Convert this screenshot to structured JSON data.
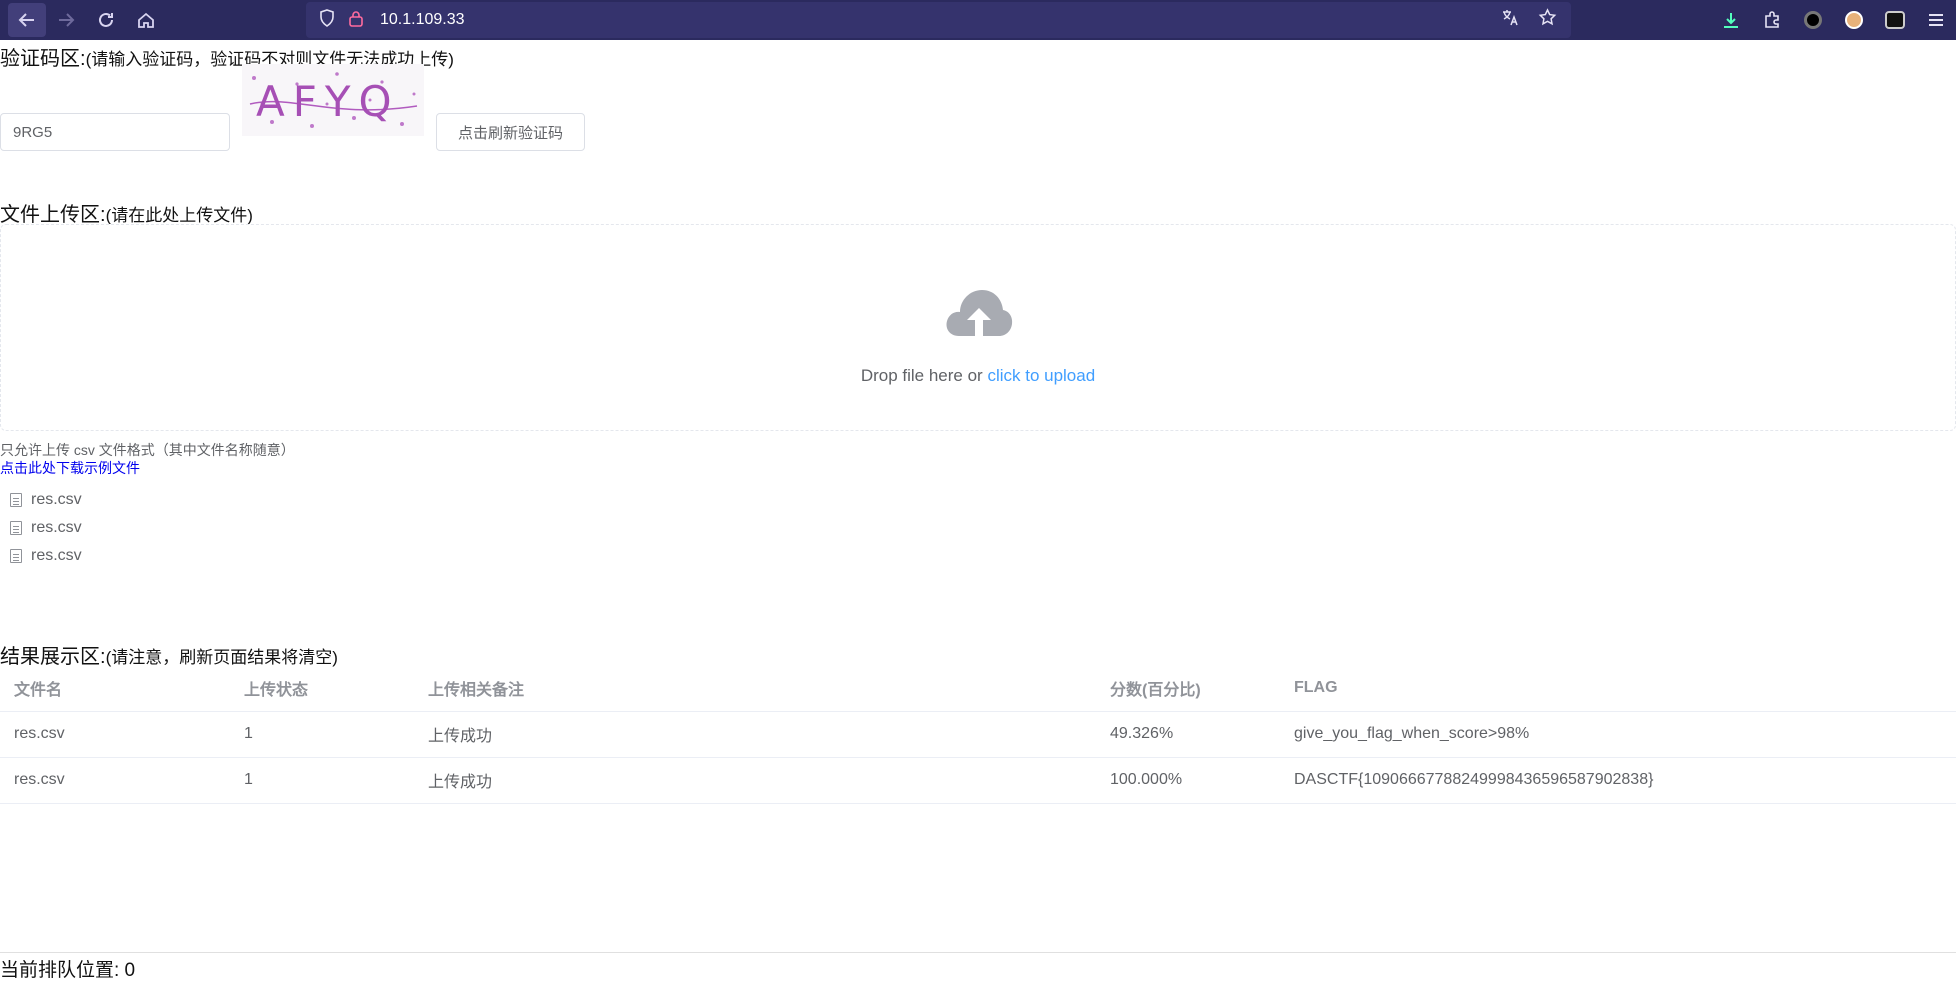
{
  "browser": {
    "url": "10.1.109.33"
  },
  "captcha": {
    "title": "验证码区:",
    "hint": "(请输入验证码，验证码不对则文件无法成功上传)",
    "input_value": "9RG5",
    "refresh_label": "点击刷新验证码",
    "image_text": "AFYQ"
  },
  "upload": {
    "title": "文件上传区:",
    "hint": "(请在此处上传文件)",
    "drop_text": "Drop file here or ",
    "click_text": "click to upload",
    "tip": "只允许上传 csv 文件格式（其中文件名称随意）",
    "download_link": "点击此处下载示例文件",
    "files": [
      "res.csv",
      "res.csv",
      "res.csv"
    ]
  },
  "results": {
    "title": "结果展示区:",
    "hint": "(请注意，刷新页面结果将清空)",
    "columns": [
      "文件名",
      "上传状态",
      "上传相关备注",
      "分数(百分比)",
      "FLAG"
    ],
    "rows": [
      [
        "res.csv",
        "1",
        "上传成功",
        "49.326%",
        "give_you_flag_when_score>98%"
      ],
      [
        "res.csv",
        "1",
        "上传成功",
        "100.000%",
        "DASCTF{10906667788249998436596587902838}"
      ]
    ]
  },
  "queue": {
    "text": "当前排队位置: 0"
  },
  "colors": {
    "toolbar": "#2b2a5e",
    "link": "#409eff",
    "border": "#dcdfe6"
  }
}
